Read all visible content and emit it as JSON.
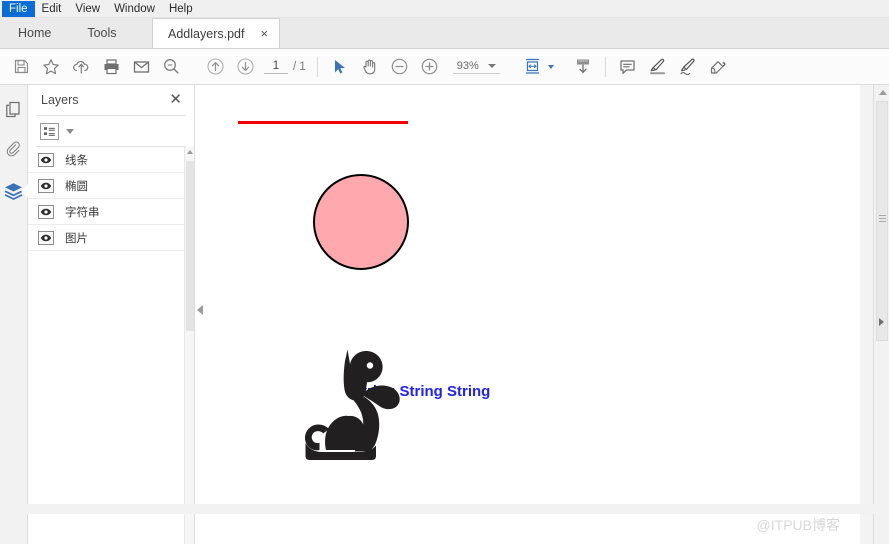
{
  "menu": {
    "items": [
      {
        "label": "File",
        "active": true
      },
      {
        "label": "Edit",
        "active": false
      },
      {
        "label": "View",
        "active": false
      },
      {
        "label": "Window",
        "active": false
      },
      {
        "label": "Help",
        "active": false
      }
    ]
  },
  "tabs": {
    "home_label": "Home",
    "tools_label": "Tools",
    "document_label": "Addlayers.pdf",
    "close_label": "×"
  },
  "toolbar": {
    "icons": [
      {
        "name": "save-icon"
      },
      {
        "name": "star-icon"
      },
      {
        "name": "cloud-upload-icon"
      },
      {
        "name": "print-icon"
      },
      {
        "name": "email-icon"
      },
      {
        "name": "search-icon"
      },
      {
        "name": "previous-page-icon"
      },
      {
        "name": "next-page-icon"
      },
      {
        "name": "select-cursor-icon"
      },
      {
        "name": "hand-tool-icon"
      },
      {
        "name": "zoom-out-icon"
      },
      {
        "name": "zoom-in-icon"
      },
      {
        "name": "fit-page-icon"
      },
      {
        "name": "download-icon"
      },
      {
        "name": "comment-icon"
      },
      {
        "name": "highlight-icon"
      },
      {
        "name": "sign-icon"
      },
      {
        "name": "stamp-icon"
      }
    ],
    "page_current": "1",
    "page_total": "/ 1",
    "zoom_level": "93%",
    "accent_color": "#3b73b9"
  },
  "rail": {
    "items": [
      {
        "name": "page-thumbnails",
        "active": false
      },
      {
        "name": "attachments",
        "active": false
      },
      {
        "name": "layers",
        "active": true
      }
    ]
  },
  "panel": {
    "title": "Layers",
    "close_label": "✕",
    "options_icon": "list-options-icon",
    "layers": [
      {
        "name": "线条",
        "visible": true
      },
      {
        "name": "椭圆",
        "visible": true
      },
      {
        "name": "字符串",
        "visible": true
      },
      {
        "name": "图片",
        "visible": true
      }
    ]
  },
  "document": {
    "line_color": "#f20000",
    "circle_fill": "#ffa8ae",
    "circle_stroke": "#000000",
    "text": "String String String",
    "text_color": "#2222ee",
    "cat_color": "#221f20",
    "watermark": "@ITPUB博客"
  }
}
